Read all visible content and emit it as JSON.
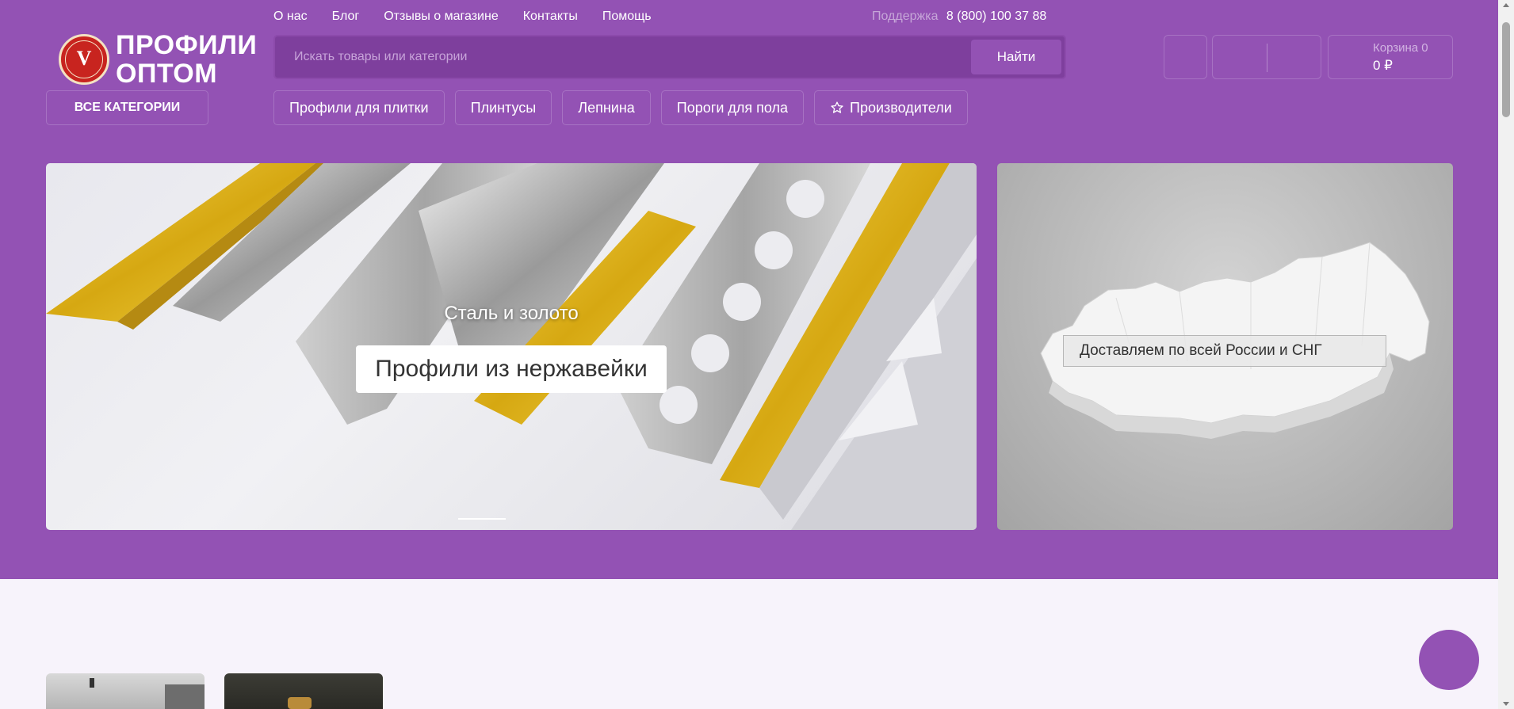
{
  "topnav": {
    "items": [
      "О нас",
      "Блог",
      "Отзывы о магазине",
      "Контакты",
      "Помощь"
    ],
    "support_label": "Поддержка",
    "support_phone": "8 (800) 100 37 88"
  },
  "logo": {
    "line1": "ПРОФИЛИ",
    "line2": "ОПТОМ",
    "badge_letter": "V"
  },
  "search": {
    "placeholder": "Искать товары или категории",
    "button_label": "Найти"
  },
  "cart": {
    "label": "Корзина 0",
    "amount": "0 ₽"
  },
  "all_categories_label": "ВСЕ КАТЕГОРИИ",
  "categories": [
    "Профили для плитки",
    "Плинтусы",
    "Лепнина",
    "Пороги для пола",
    "Производители"
  ],
  "hero": {
    "subtitle": "Сталь и золото",
    "title": "Профили из нержавейки"
  },
  "side_banner": {
    "label": "Доставляем по всей России и СНГ"
  },
  "colors": {
    "brand": "#9352b4",
    "page_background": "#f7f3fb",
    "search_background": "#7e3f9d"
  },
  "icons": [
    "star-icon",
    "logo-badge-icon"
  ]
}
